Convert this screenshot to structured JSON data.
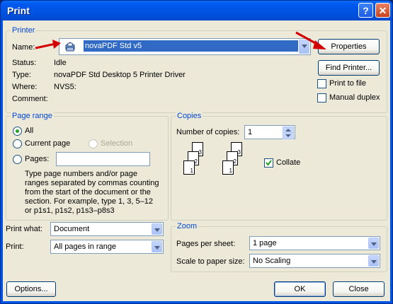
{
  "window": {
    "title": "Print",
    "help_label": "?",
    "close_label": "✕"
  },
  "printer": {
    "group_label": "Printer",
    "name_label": "Name:",
    "name_value": "novaPDF Std v5",
    "status_label": "Status:",
    "status_value": "Idle",
    "type_label": "Type:",
    "type_value": "novaPDF Std Desktop 5 Printer Driver",
    "where_label": "Where:",
    "where_value": "NVS5:",
    "comment_label": "Comment:",
    "comment_value": "",
    "properties_label": "Properties",
    "find_printer_label": "Find Printer...",
    "print_to_file_label": "Print to file",
    "manual_duplex_label": "Manual duplex",
    "printer_icon": "printer-icon",
    "annotation_arrow_color": "#d20000"
  },
  "page_range": {
    "group_label": "Page range",
    "all_label": "All",
    "current_page_label": "Current page",
    "selection_label": "Selection",
    "pages_label": "Pages:",
    "pages_value": "",
    "help_text": "Type page numbers and/or page ranges separated by commas counting from the start of the document or the section. For example, type 1, 3, 5–12 or p1s1, p1s2, p1s3–p8s3"
  },
  "copies": {
    "group_label": "Copies",
    "number_label": "Number of copies:",
    "number_value": "1",
    "collate_label": "Collate",
    "collate_checked": true,
    "page_numbers": [
      "3",
      "2",
      "1",
      "3",
      "2",
      "1"
    ]
  },
  "print_what": {
    "label": "Print what:",
    "value": "Document"
  },
  "print": {
    "label": "Print:",
    "value": "All pages in range"
  },
  "zoom": {
    "group_label": "Zoom",
    "pages_per_sheet_label": "Pages per sheet:",
    "pages_per_sheet_value": "1 page",
    "scale_label": "Scale to paper size:",
    "scale_value": "No Scaling"
  },
  "footer": {
    "options_label": "Options...",
    "ok_label": "OK",
    "close_label": "Close"
  }
}
